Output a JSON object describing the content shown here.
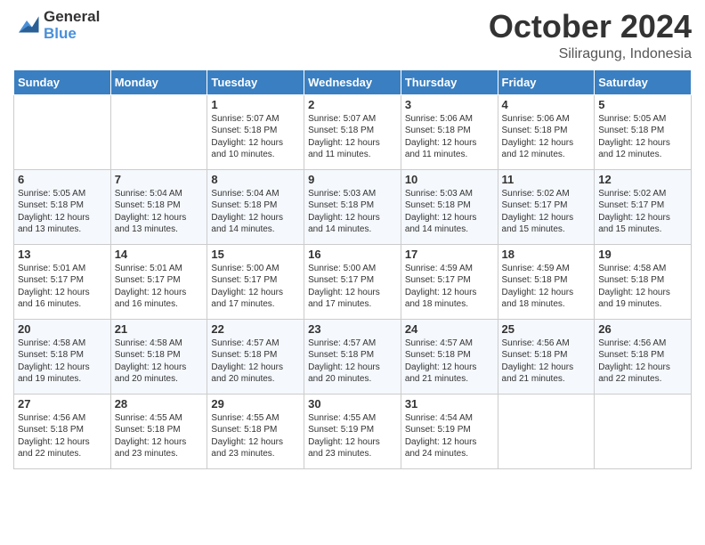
{
  "logo": {
    "line1": "General",
    "line2": "Blue"
  },
  "title": "October 2024",
  "location": "Siliragung, Indonesia",
  "days_header": [
    "Sunday",
    "Monday",
    "Tuesday",
    "Wednesday",
    "Thursday",
    "Friday",
    "Saturday"
  ],
  "weeks": [
    [
      {
        "day": "",
        "info": ""
      },
      {
        "day": "",
        "info": ""
      },
      {
        "day": "1",
        "info": "Sunrise: 5:07 AM\nSunset: 5:18 PM\nDaylight: 12 hours\nand 10 minutes."
      },
      {
        "day": "2",
        "info": "Sunrise: 5:07 AM\nSunset: 5:18 PM\nDaylight: 12 hours\nand 11 minutes."
      },
      {
        "day": "3",
        "info": "Sunrise: 5:06 AM\nSunset: 5:18 PM\nDaylight: 12 hours\nand 11 minutes."
      },
      {
        "day": "4",
        "info": "Sunrise: 5:06 AM\nSunset: 5:18 PM\nDaylight: 12 hours\nand 12 minutes."
      },
      {
        "day": "5",
        "info": "Sunrise: 5:05 AM\nSunset: 5:18 PM\nDaylight: 12 hours\nand 12 minutes."
      }
    ],
    [
      {
        "day": "6",
        "info": "Sunrise: 5:05 AM\nSunset: 5:18 PM\nDaylight: 12 hours\nand 13 minutes."
      },
      {
        "day": "7",
        "info": "Sunrise: 5:04 AM\nSunset: 5:18 PM\nDaylight: 12 hours\nand 13 minutes."
      },
      {
        "day": "8",
        "info": "Sunrise: 5:04 AM\nSunset: 5:18 PM\nDaylight: 12 hours\nand 14 minutes."
      },
      {
        "day": "9",
        "info": "Sunrise: 5:03 AM\nSunset: 5:18 PM\nDaylight: 12 hours\nand 14 minutes."
      },
      {
        "day": "10",
        "info": "Sunrise: 5:03 AM\nSunset: 5:18 PM\nDaylight: 12 hours\nand 14 minutes."
      },
      {
        "day": "11",
        "info": "Sunrise: 5:02 AM\nSunset: 5:17 PM\nDaylight: 12 hours\nand 15 minutes."
      },
      {
        "day": "12",
        "info": "Sunrise: 5:02 AM\nSunset: 5:17 PM\nDaylight: 12 hours\nand 15 minutes."
      }
    ],
    [
      {
        "day": "13",
        "info": "Sunrise: 5:01 AM\nSunset: 5:17 PM\nDaylight: 12 hours\nand 16 minutes."
      },
      {
        "day": "14",
        "info": "Sunrise: 5:01 AM\nSunset: 5:17 PM\nDaylight: 12 hours\nand 16 minutes."
      },
      {
        "day": "15",
        "info": "Sunrise: 5:00 AM\nSunset: 5:17 PM\nDaylight: 12 hours\nand 17 minutes."
      },
      {
        "day": "16",
        "info": "Sunrise: 5:00 AM\nSunset: 5:17 PM\nDaylight: 12 hours\nand 17 minutes."
      },
      {
        "day": "17",
        "info": "Sunrise: 4:59 AM\nSunset: 5:17 PM\nDaylight: 12 hours\nand 18 minutes."
      },
      {
        "day": "18",
        "info": "Sunrise: 4:59 AM\nSunset: 5:18 PM\nDaylight: 12 hours\nand 18 minutes."
      },
      {
        "day": "19",
        "info": "Sunrise: 4:58 AM\nSunset: 5:18 PM\nDaylight: 12 hours\nand 19 minutes."
      }
    ],
    [
      {
        "day": "20",
        "info": "Sunrise: 4:58 AM\nSunset: 5:18 PM\nDaylight: 12 hours\nand 19 minutes."
      },
      {
        "day": "21",
        "info": "Sunrise: 4:58 AM\nSunset: 5:18 PM\nDaylight: 12 hours\nand 20 minutes."
      },
      {
        "day": "22",
        "info": "Sunrise: 4:57 AM\nSunset: 5:18 PM\nDaylight: 12 hours\nand 20 minutes."
      },
      {
        "day": "23",
        "info": "Sunrise: 4:57 AM\nSunset: 5:18 PM\nDaylight: 12 hours\nand 20 minutes."
      },
      {
        "day": "24",
        "info": "Sunrise: 4:57 AM\nSunset: 5:18 PM\nDaylight: 12 hours\nand 21 minutes."
      },
      {
        "day": "25",
        "info": "Sunrise: 4:56 AM\nSunset: 5:18 PM\nDaylight: 12 hours\nand 21 minutes."
      },
      {
        "day": "26",
        "info": "Sunrise: 4:56 AM\nSunset: 5:18 PM\nDaylight: 12 hours\nand 22 minutes."
      }
    ],
    [
      {
        "day": "27",
        "info": "Sunrise: 4:56 AM\nSunset: 5:18 PM\nDaylight: 12 hours\nand 22 minutes."
      },
      {
        "day": "28",
        "info": "Sunrise: 4:55 AM\nSunset: 5:18 PM\nDaylight: 12 hours\nand 23 minutes."
      },
      {
        "day": "29",
        "info": "Sunrise: 4:55 AM\nSunset: 5:18 PM\nDaylight: 12 hours\nand 23 minutes."
      },
      {
        "day": "30",
        "info": "Sunrise: 4:55 AM\nSunset: 5:19 PM\nDaylight: 12 hours\nand 23 minutes."
      },
      {
        "day": "31",
        "info": "Sunrise: 4:54 AM\nSunset: 5:19 PM\nDaylight: 12 hours\nand 24 minutes."
      },
      {
        "day": "",
        "info": ""
      },
      {
        "day": "",
        "info": ""
      }
    ]
  ]
}
